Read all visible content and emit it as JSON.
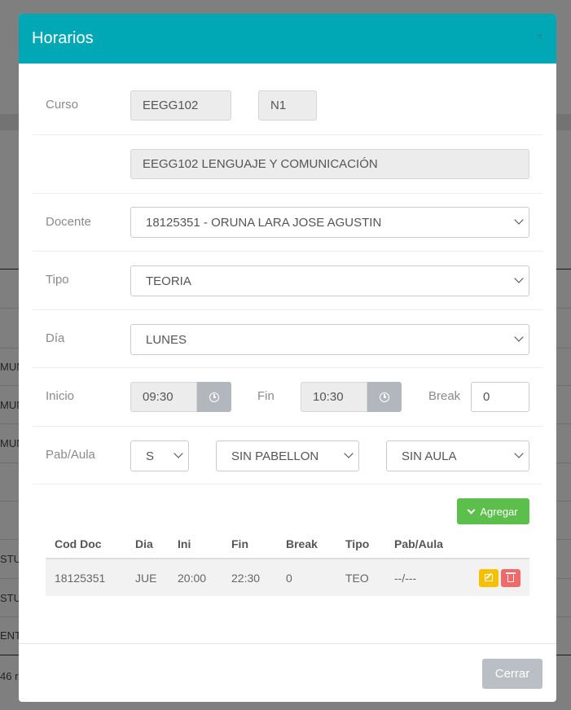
{
  "background": {
    "fragments": [
      "MUN",
      "MUN",
      "MUN",
      "STU",
      "STU",
      "ENTA",
      "46 r"
    ]
  },
  "modal": {
    "title": "Horarios",
    "close_label": "×",
    "form": {
      "curso_label": "Curso",
      "curso_code": "EEGG102",
      "curso_section": "N1",
      "curso_name": "EEGG102 LENGUAJE Y COMUNICACIÓN",
      "docente_label": "Docente",
      "docente_value": "18125351 - ORUNA LARA JOSE AGUSTIN",
      "tipo_label": "Tipo",
      "tipo_value": "TEORIA",
      "dia_label": "Día",
      "dia_value": "LUNES",
      "inicio_label": "Inicio",
      "inicio_value": "09:30",
      "fin_label": "Fin",
      "fin_value": "10:30",
      "break_label": "Break",
      "break_value": "0",
      "pabaula_label": "Pab/Aula",
      "sede_value": "S",
      "pabellon_value": "SIN PABELLON",
      "aula_value": "SIN AULA"
    },
    "add_button_label": "Agregar",
    "table": {
      "headers": [
        "Cod Doc",
        "Dia",
        "Ini",
        "Fin",
        "Break",
        "Tipo",
        "Pab/Aula",
        ""
      ],
      "rows": [
        {
          "cod_doc": "18125351",
          "dia": "JUE",
          "ini": "20:00",
          "fin": "22:30",
          "break": "0",
          "tipo": "TEO",
          "pab_aula": "--/---"
        }
      ]
    },
    "close_button_label": "Cerrar"
  },
  "colors": {
    "header": "#00a7b5",
    "add_button": "#5cbf4c",
    "edit_button": "#f5c000",
    "delete_button": "#f06a6a",
    "close_button": "#b9bfc5"
  },
  "icons": {
    "close": "close-icon",
    "clock": "clock-icon",
    "chevron": "chevron-down-icon",
    "edit": "edit-icon",
    "delete": "trash-icon"
  }
}
